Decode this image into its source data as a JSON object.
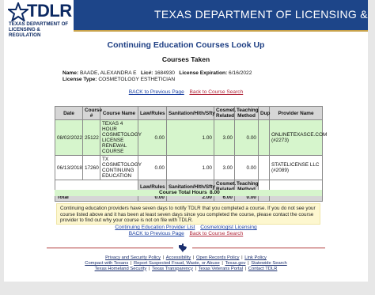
{
  "logo": {
    "word": "TDLR",
    "sub_line1": "Texas Department of",
    "sub_line2": "Licensing & Regulation"
  },
  "banner": {
    "title": "TEXAS DEPARTMENT OF LICENSING & REGULATION",
    "background": "#1d4589"
  },
  "page_title": "Continuing Education Courses Look Up",
  "subtitle": "Courses Taken",
  "licensee": {
    "name_label": "Name:",
    "name_value": "BAADE, ALEXANDRA E",
    "lic_label": "Lic#:",
    "lic_value": "1684930",
    "exp_label": "License Expiration:",
    "exp_value": "6/16/2022",
    "type_label": "License Type:",
    "type_value": "COSMETOLOGY ESTHETICIAN"
  },
  "top_links": {
    "back_prev": "BACK to Previous Page",
    "back_search": "Back to Course Search"
  },
  "table": {
    "headers": {
      "date": "Date",
      "course_no": "Course #",
      "course_name": "Course Name",
      "law_rules": "Law/Rules",
      "sanitation": "Sanitation/Hlth/Sfty",
      "cosmet_related": "Cosmet. Related",
      "teaching": "Teaching Method",
      "dup": "Dup",
      "provider": "Provider Name"
    },
    "rows": [
      {
        "date": "08/02/2022",
        "course_no": "25122",
        "course_name": "TEXAS 4 HOUR COSMETOLOGY LICENSE RENEWAL COURSE",
        "law_rules": "0.00",
        "sanitation": "1.00",
        "cosmet_related": "3.00",
        "teaching": "0.00",
        "dup": "",
        "provider": "ONLINETEXASCE.COM (#2273)"
      },
      {
        "date": "06/13/2018",
        "course_no": "17260",
        "course_name": "TX COSMETOLOGY CONTINUING EDUCATION",
        "law_rules": "0.00",
        "sanitation": "1.00",
        "cosmet_related": "3.00",
        "teaching": "0.00",
        "dup": "",
        "provider": "STATELICENSE LLC (#2089)"
      }
    ],
    "subheaders": {
      "law_rules": "Law/Rules",
      "sanitation": "Sanitation/Hlth/Sfty",
      "cosmet_related": "Cosmet. Related",
      "teaching": "Teaching Method"
    },
    "total": {
      "label": "Total",
      "law_rules": "0.00",
      "sanitation": "2.00",
      "cosmet_related": "6.00",
      "teaching": "0.00"
    }
  },
  "grand_total": {
    "label": "Course Total Hours",
    "value": "8.00"
  },
  "notice": "Continuing education providers have seven days to notify TDLR that you completed a course. If you do not see your course listed above and it has been at least seven days since you completed the course, please contact the course provider to find out why your course is not on file with TDLR.",
  "bottom_links": {
    "provider_list": "Continuing Education Provider List",
    "cosmo_licensing": "Cosmetologist Licensing",
    "back_prev": "BACK to Previous Page",
    "back_search": "Back to Course Search"
  },
  "footer": {
    "row1": [
      "Privacy and Security Policy",
      "Accessibility",
      "Open Records Policy",
      "Link Policy"
    ],
    "row2": [
      "Compact with Texans",
      "Report Suspected Fraud, Waste, or Abuse",
      "Texas.gov",
      "Statewide Search"
    ],
    "row3": [
      "Texas Homeland Security",
      "Texas Transparency",
      "Texas Veterans Portal",
      "Contact TDLR"
    ]
  }
}
